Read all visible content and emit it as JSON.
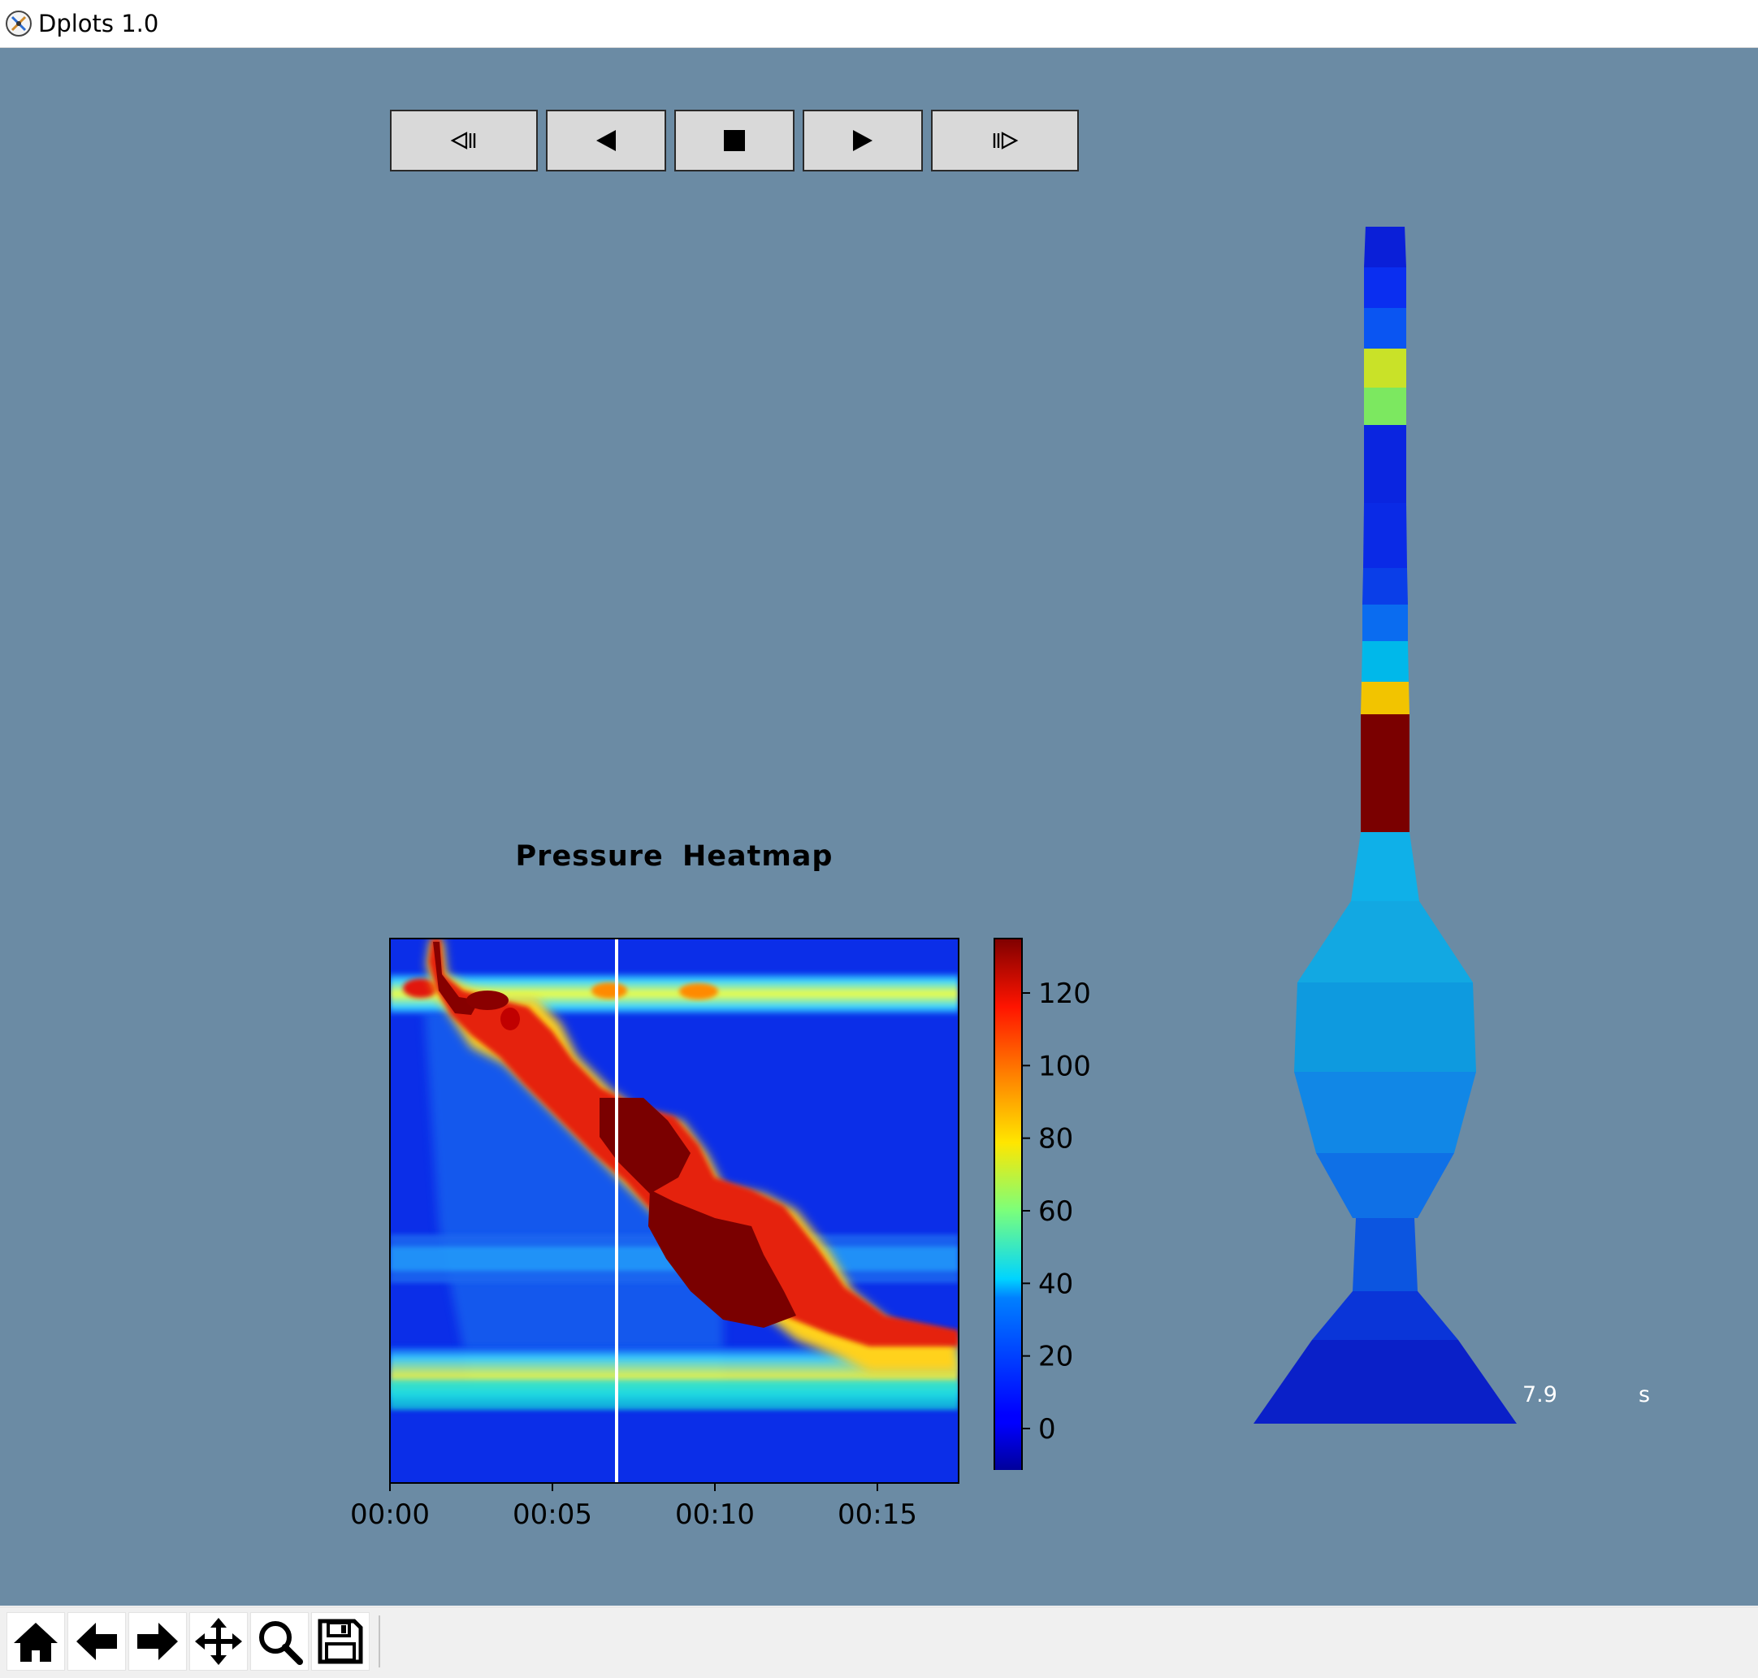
{
  "window": {
    "title": "Dplots 1.0",
    "icon": "dplots-app-icon"
  },
  "animation_controls": [
    {
      "name": "step-back",
      "icon": "step-back-icon",
      "label": "⧏"
    },
    {
      "name": "play-reverse",
      "icon": "play-reverse-icon",
      "label": "◀"
    },
    {
      "name": "stop",
      "icon": "stop-icon",
      "label": "■"
    },
    {
      "name": "play-forward",
      "icon": "play-forward-icon",
      "label": "▶"
    },
    {
      "name": "step-forward",
      "icon": "step-forward-icon",
      "label": "⧐"
    }
  ],
  "chart_data": [
    {
      "type": "heatmap",
      "title": "Pressure  Heatmap",
      "xlabel": "",
      "ylabel": "",
      "x_ticks": [
        "00:00",
        "00:05",
        "00:10",
        "00:15"
      ],
      "x_tick_seconds": [
        0,
        5,
        10,
        15
      ],
      "xlim_seconds": [
        0,
        17.5
      ],
      "y_ticks": [],
      "colormap": "jet",
      "colorbar": {
        "ticks": [
          120,
          100,
          80,
          60,
          40,
          20,
          0
        ],
        "range": [
          -15,
          135
        ]
      },
      "current_time_marker_seconds": 7.9,
      "features": [
        {
          "description": "upper band",
          "level": 0.18,
          "pressure_approx": 40
        },
        {
          "description": "lower band",
          "level": 0.86,
          "pressure_approx": 45
        },
        {
          "description": "peristaltic wave",
          "start_s": 1.3,
          "end_s": 15.5,
          "peak_pressure": 135
        }
      ]
    }
  ],
  "esophagus_model": {
    "segment_colors_top_to_bottom": [
      "#0a1fd8",
      "#0a2ef0",
      "#0a55f2",
      "#c9e228",
      "#7ce860",
      "#0a25e0",
      "#0a2ae6",
      "#0a3ee8",
      "#0a6cf0",
      "#00b8ea",
      "#f2c400",
      "#7a0000",
      "#0fb0e8",
      "#12a8e2",
      "#0e9adf",
      "#1187e6",
      "#0f70e6",
      "#0c55e0",
      "#0a35d8",
      "#0a20c8"
    ],
    "time_value": "7.9",
    "time_unit": "s"
  },
  "toolbar": [
    {
      "name": "home-button",
      "icon": "home-icon"
    },
    {
      "name": "back-button",
      "icon": "arrow-left-icon"
    },
    {
      "name": "forward-button",
      "icon": "arrow-right-icon"
    },
    {
      "name": "pan-button",
      "icon": "move-icon"
    },
    {
      "name": "zoom-button",
      "icon": "magnifier-icon"
    },
    {
      "name": "save-button",
      "icon": "floppy-disk-icon"
    }
  ]
}
